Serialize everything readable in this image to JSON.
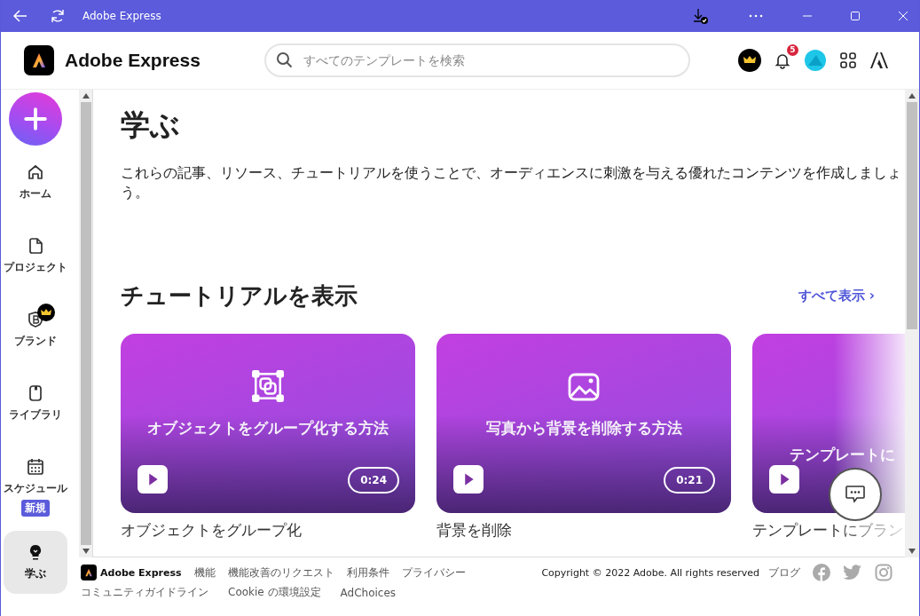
{
  "window": {
    "title": "Adobe Express"
  },
  "header": {
    "app_name": "Adobe Express",
    "search": {
      "placeholder": "すべてのテンプレートを検索"
    },
    "notification_count": "5"
  },
  "sidebar": {
    "items": [
      {
        "label": "ホーム",
        "selected": false,
        "premium": false
      },
      {
        "label": "プロジェクト",
        "selected": false,
        "premium": false
      },
      {
        "label": "ブランド",
        "selected": false,
        "premium": true
      },
      {
        "label": "ライブラリ",
        "selected": false,
        "premium": false
      },
      {
        "label": "スケジュール",
        "selected": false,
        "premium": false,
        "badge": "新規"
      },
      {
        "label": "学ぶ",
        "selected": true,
        "premium": false
      }
    ]
  },
  "page": {
    "title": "学ぶ",
    "description": "これらの記事、リソース、チュートリアルを使うことで、オーディエンスに刺激を与える優れたコンテンツを作成しましょう。"
  },
  "tutorials": {
    "heading": "チュートリアルを表示",
    "see_all": "すべて表示 ›",
    "cards": [
      {
        "kind": "group",
        "title": "オブジェクトをグループ化する方法",
        "duration": "0:24",
        "caption": "オブジェクトをグループ化"
      },
      {
        "kind": "image",
        "title": "写真から背景を削除する方法",
        "duration": "0:21",
        "caption": "背景を削除"
      },
      {
        "kind": "brand",
        "title": "テンプレートに",
        "caption": "テンプレートにブラン"
      }
    ]
  },
  "footer": {
    "brand": "Adobe Express",
    "links": [
      {
        "label": "機能"
      },
      {
        "label": "機能改善のリクエスト"
      },
      {
        "label": "利用条件"
      },
      {
        "label": "プライバシー"
      }
    ],
    "copyright": "Copyright © 2022 Adobe. All rights reserved",
    "blog": "ブログ",
    "links_2": [
      {
        "label": "コミュニティガイドライン"
      },
      {
        "label": "Cookie の環境設定"
      },
      {
        "label": "AdChoices"
      }
    ]
  }
}
